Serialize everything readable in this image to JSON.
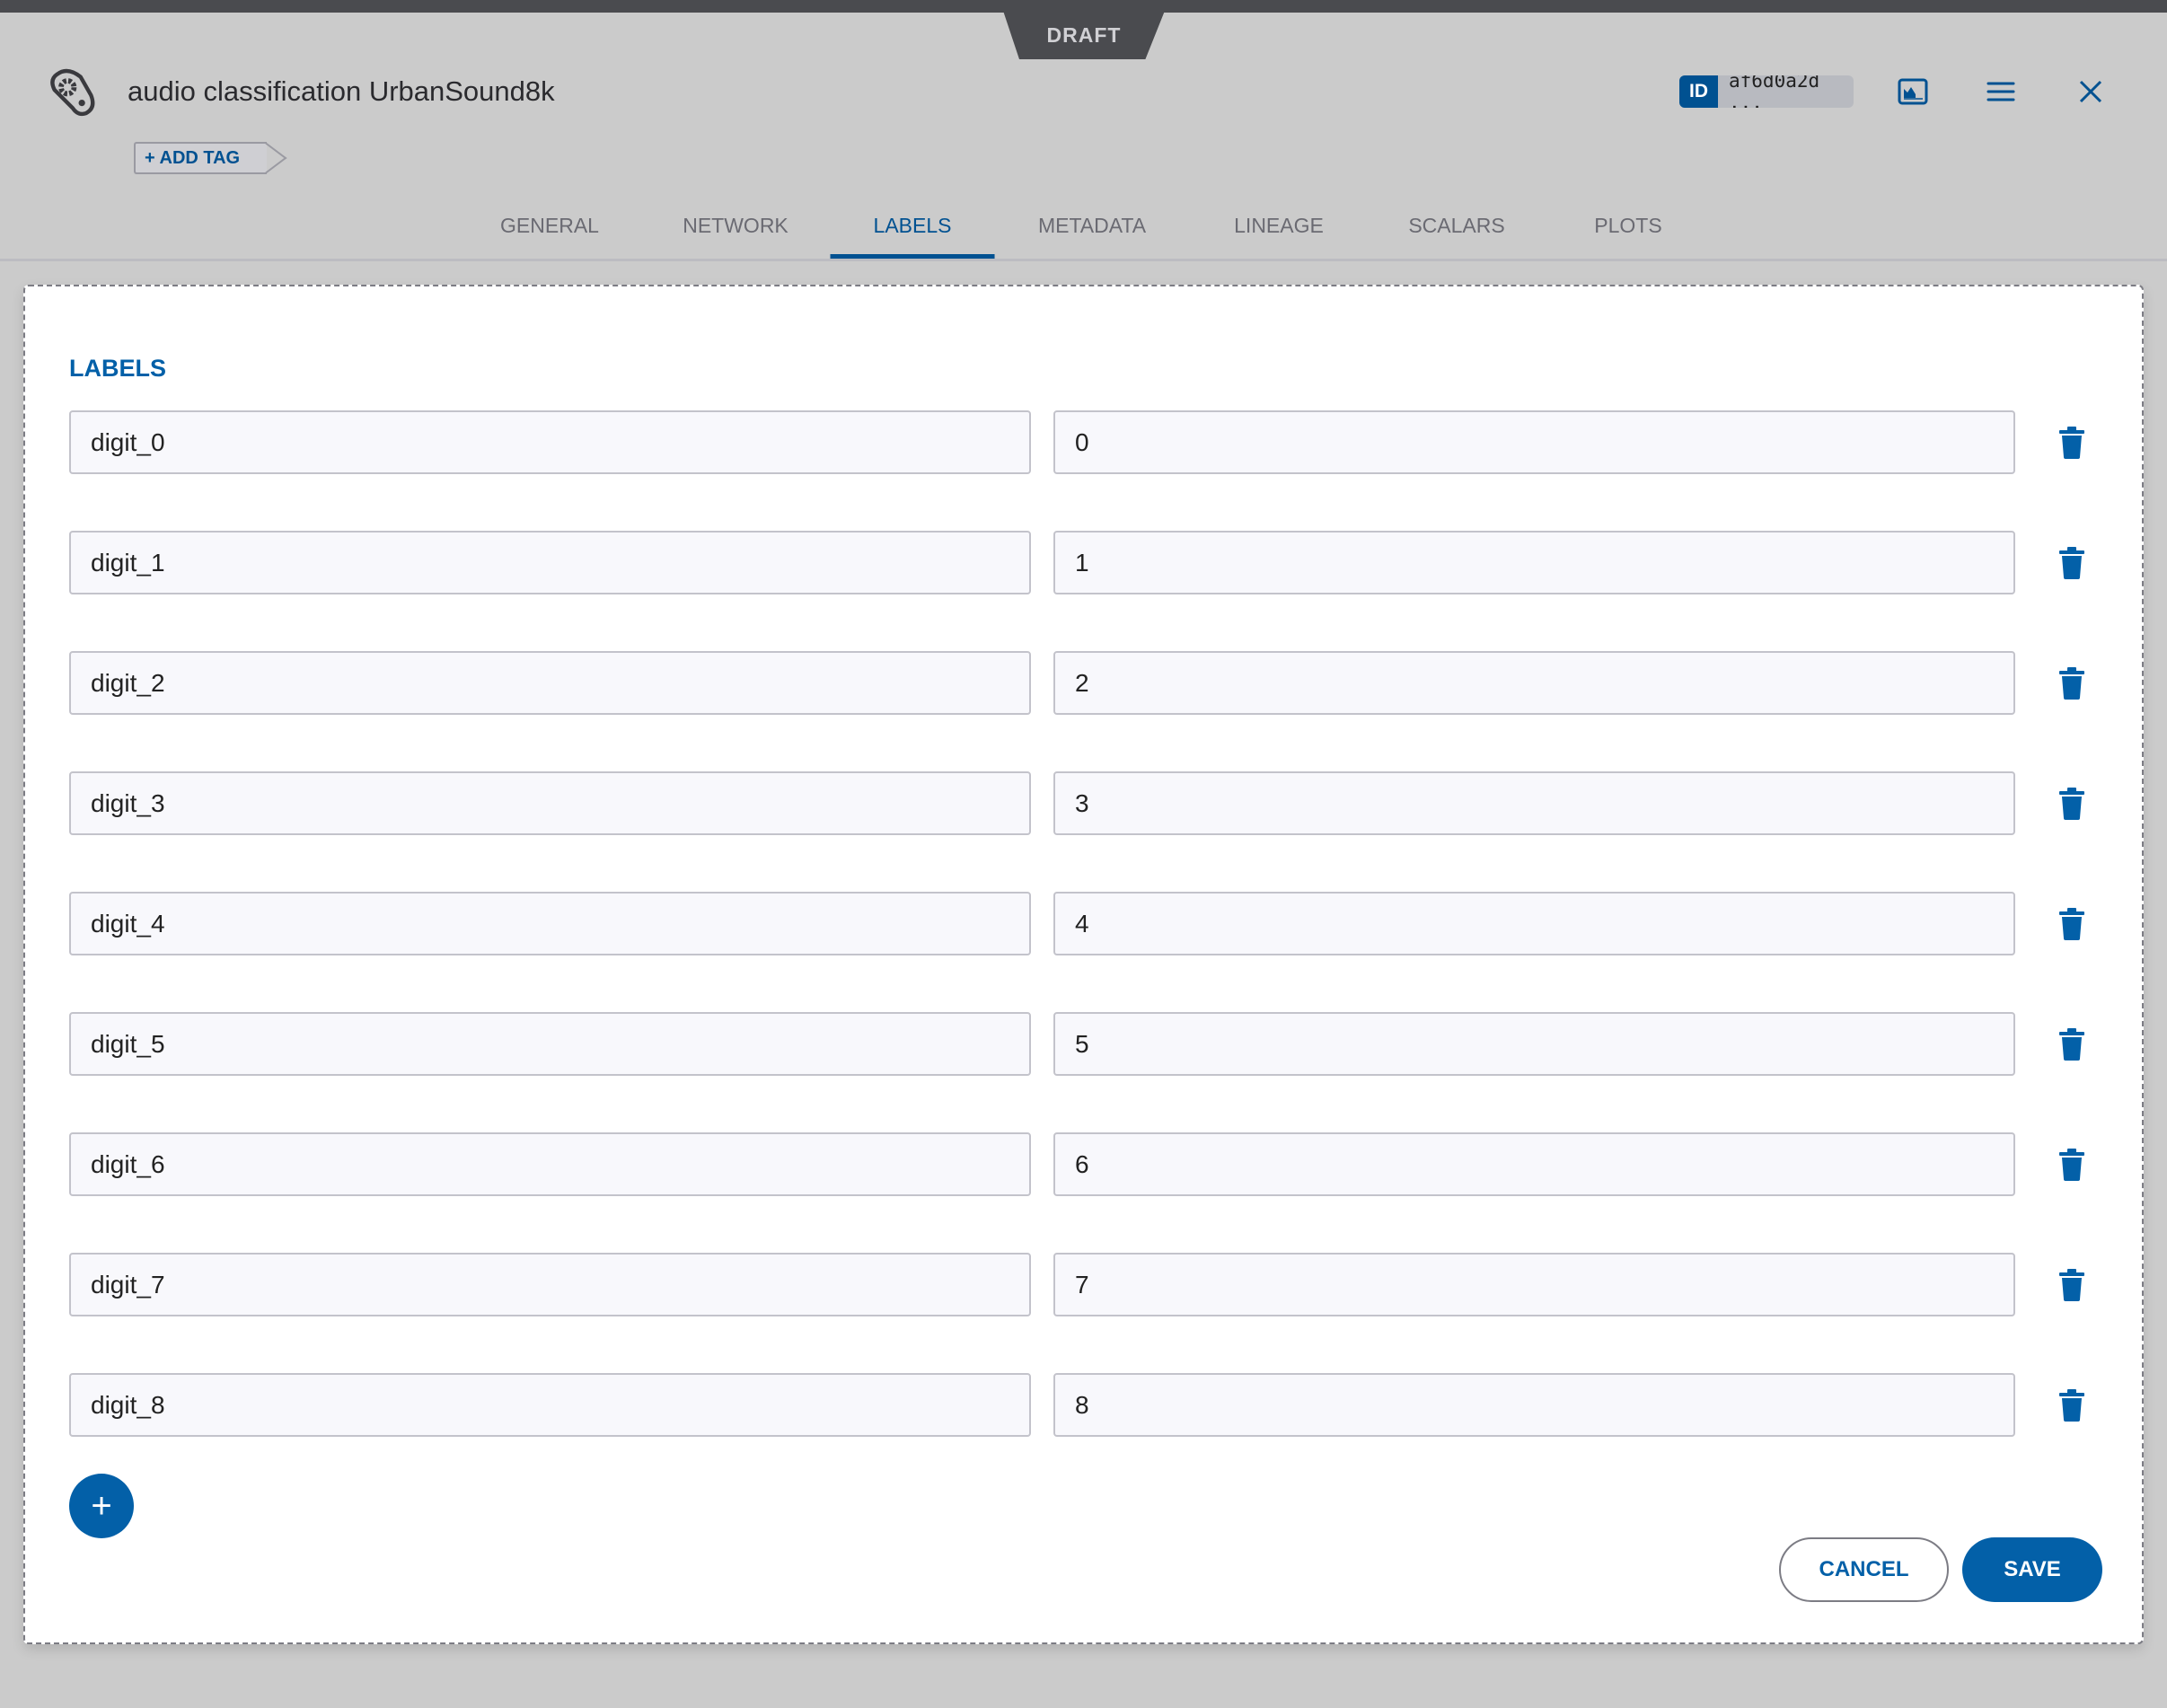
{
  "header": {
    "status": "DRAFT",
    "title": "audio classification UrbanSound8k",
    "add_tag": "+ ADD TAG",
    "id_label": "ID",
    "id_value": "af6d0a2d ...",
    "icons": [
      "experiment-icon",
      "image-icon",
      "menu-icon",
      "close-icon"
    ]
  },
  "tabs": [
    {
      "label": "GENERAL"
    },
    {
      "label": "NETWORK"
    },
    {
      "label": "LABELS",
      "active": true
    },
    {
      "label": "METADATA"
    },
    {
      "label": "LINEAGE"
    },
    {
      "label": "SCALARS"
    },
    {
      "label": "PLOTS"
    }
  ],
  "labels": {
    "heading": "LABELS",
    "rows": [
      {
        "name": "digit_0",
        "value": "0"
      },
      {
        "name": "digit_1",
        "value": "1"
      },
      {
        "name": "digit_2",
        "value": "2"
      },
      {
        "name": "digit_3",
        "value": "3"
      },
      {
        "name": "digit_4",
        "value": "4"
      },
      {
        "name": "digit_5",
        "value": "5"
      },
      {
        "name": "digit_6",
        "value": "6"
      },
      {
        "name": "digit_7",
        "value": "7"
      },
      {
        "name": "digit_8",
        "value": "8"
      }
    ]
  },
  "actions": {
    "add": "+",
    "cancel": "CANCEL",
    "save": "SAVE"
  },
  "colors": {
    "accent": "#0360a8",
    "dark": "#4a4b4f",
    "background": "#cbcbcb"
  }
}
